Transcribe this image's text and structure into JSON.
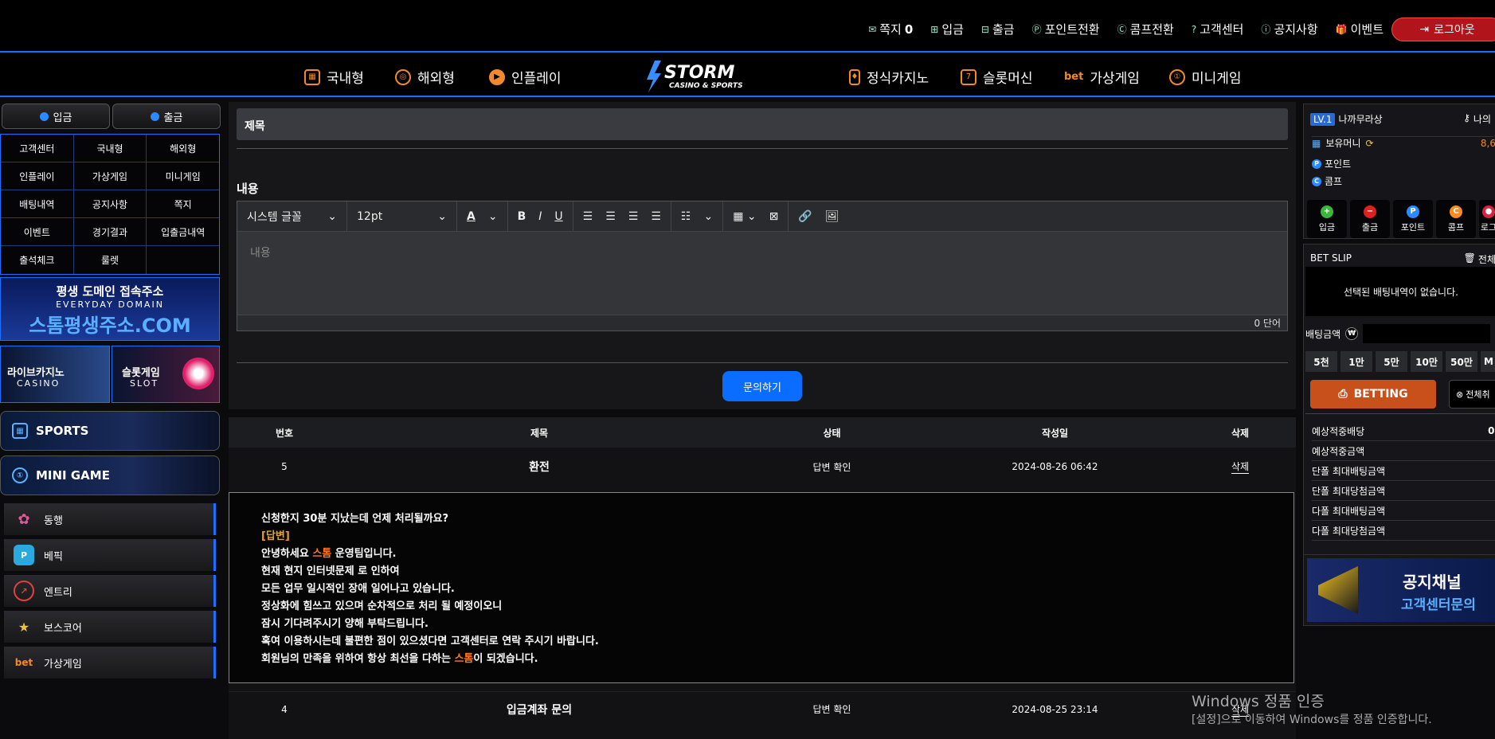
{
  "top": {
    "links": [
      {
        "icon": "envelope-icon",
        "glyph": "✉",
        "label": "쪽지",
        "count": "0"
      },
      {
        "icon": "plus-box-icon",
        "glyph": "⊞",
        "label": "입금"
      },
      {
        "icon": "minus-box-icon",
        "glyph": "⊟",
        "label": "출금"
      },
      {
        "icon": "point-icon",
        "glyph": "Ⓟ",
        "label": "포인트전환"
      },
      {
        "icon": "comp-icon",
        "glyph": "Ⓒ",
        "label": "콤프전환"
      },
      {
        "icon": "help-icon",
        "glyph": "?",
        "label": "고객센터"
      },
      {
        "icon": "info-icon",
        "glyph": "ⓘ",
        "label": "공지사항"
      },
      {
        "icon": "gift-icon",
        "glyph": "🎁",
        "label": "이벤트"
      }
    ],
    "logout": "로그아웃"
  },
  "nav": {
    "left": [
      "국내형",
      "해외형",
      "인플레이"
    ],
    "right": [
      "정식카지노",
      "슬롯머신",
      "가상게임",
      "미니게임"
    ],
    "logo_text": "STORM",
    "logo_sub": "CASINO & SPORTS"
  },
  "left": {
    "deposit": "입금",
    "withdraw": "출금",
    "grid": [
      [
        "고객센터",
        "국내형",
        "해외형"
      ],
      [
        "인플레이",
        "가상게임",
        "미니게임"
      ],
      [
        "배팅내역",
        "공지사항",
        "쪽지"
      ],
      [
        "이벤트",
        "경기결과",
        "입출금내역"
      ],
      [
        "출석체크",
        "룰렛",
        ""
      ]
    ],
    "banner_domain_1": "평생 도메인 접속주소",
    "banner_domain_2": "EVERYDAY DOMAIN",
    "banner_domain_3": "스톰평생주소.COM",
    "banner_casino_1": "라이브카지노",
    "banner_casino_2": "CASINO",
    "banner_slot_1": "슬롯게임",
    "banner_slot_2": "SLOT",
    "sports": "SPORTS",
    "minigame": "MINI GAME",
    "providers": [
      "동행",
      "베픽",
      "엔트리",
      "보스코어",
      "가상게임"
    ]
  },
  "form": {
    "title": "제목",
    "content_label": "내용",
    "font_select": "시스템 글꼴",
    "size_select": "12pt",
    "placeholder": "내용",
    "word_count": "0 단어",
    "submit": "문의하기"
  },
  "list": {
    "headers": [
      "번호",
      "제목",
      "상태",
      "작성일",
      "삭제"
    ],
    "rows": [
      {
        "no": "5",
        "title": "환전",
        "status": "답변 확인",
        "date": "2024-08-26 06:42",
        "del": "삭제"
      },
      {
        "no": "4",
        "title": "입금계좌 문의",
        "status": "답변 확인",
        "date": "2024-08-25 23:14",
        "del": "삭제"
      }
    ],
    "answer": {
      "question": "신청한지 30분 지났는데 언제 처리될까요?",
      "tag": "[답변]",
      "l1a": "안녕하세요 ",
      "l1b": "스톰",
      "l1c": " 운영팀입니다.",
      "l2": "현재 현지 인터넷문제 로 인하여",
      "l3": "모든 업무 일시적인 장애 일어나고 있습니다.",
      "l4": "정상화에 힘쓰고 있으며 순차적으로 처리 될 예정이오니",
      "l5": "잠시 기다려주시기 양해 부탁드립니다.",
      "l6": "혹여 이용하시는데 불편한 점이 있으셨다면 고객센터로 연락 주시기 바랍니다.",
      "l7a": "회원님의 만족을 위하여 항상 최선을 다하는 ",
      "l7b": "스톰",
      "l7c": "이 되겠습니다."
    }
  },
  "right": {
    "level": "LV.1",
    "username": "나까무라상",
    "my": "나의",
    "money_label": "보유머니",
    "money_value": "8,6",
    "point_label": "포인트",
    "comp_label": "콤프",
    "buttons": [
      {
        "label": "입금",
        "glyph": "+",
        "color": "#3bb83b"
      },
      {
        "label": "출금",
        "glyph": "−",
        "color": "#e02020"
      },
      {
        "label": "포인트",
        "glyph": "P",
        "color": "#2a8aff"
      },
      {
        "label": "콤프",
        "glyph": "C",
        "color": "#ff8a20"
      },
      {
        "label": "로그",
        "glyph": "●",
        "color": "#e02040"
      }
    ],
    "betslip": "BET SLIP",
    "betslip_all": "전체",
    "betslip_empty": "선택된 배팅내역이 없습니다.",
    "bet_amount": "배팅금액",
    "amounts": [
      "5천",
      "1만",
      "5만",
      "10만",
      "50만",
      "M"
    ],
    "betting": "BETTING",
    "clear_all": "전체취",
    "info": [
      "예상적중배당",
      "예상적중금액",
      "단폴 최대배팅금액",
      "단폴 최대당첨금액",
      "다폴 최대배팅금액",
      "다폴 최대당첨금액"
    ],
    "info_value_first": "0(",
    "notice_1": "공지채널",
    "notice_2": "고객센터문의"
  },
  "watermark": {
    "line1": "Windows 정품 인증",
    "line2": "[설정]으로 이동하여 Windows를 정품 인증합니다."
  },
  "colors": {
    "accent": "#1b6fff",
    "brand_orange": "#ff7a20",
    "logout_red": "#b2141c",
    "submit_blue": "#0a6dff"
  }
}
